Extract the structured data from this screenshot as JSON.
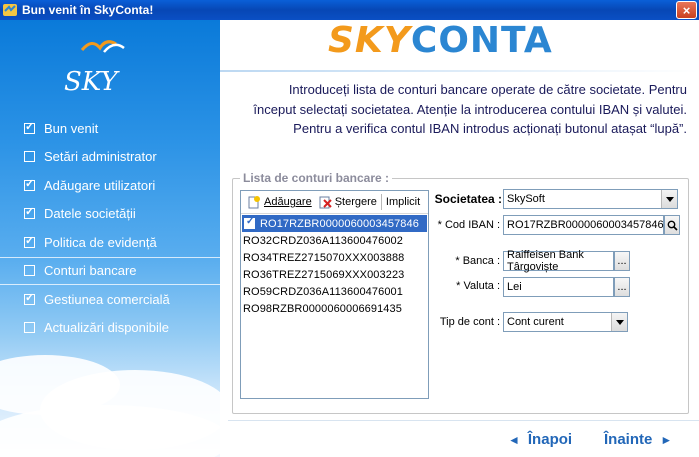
{
  "window": {
    "title": "Bun venit în SkyConta!",
    "close_symbol": "×"
  },
  "brand": {
    "sky": "SKY",
    "conta": "CONTA",
    "logo_text": "SKY"
  },
  "sidebar": {
    "items": [
      {
        "label": "Bun venit",
        "checked": true
      },
      {
        "label": "Setări administrator",
        "checked": false
      },
      {
        "label": "Adăugare utilizatori",
        "checked": true
      },
      {
        "label": "Datele societății",
        "checked": true
      },
      {
        "label": "Politica de evidență",
        "checked": true
      },
      {
        "label": "Conturi bancare",
        "checked": false,
        "active": true
      },
      {
        "label": "Gestiunea comercială",
        "checked": true
      },
      {
        "label": "Actualizări disponibile",
        "checked": false
      }
    ]
  },
  "intro": {
    "line1": "Introduceți lista de conturi bancare operate de către societate. Pentru",
    "line2": "început selectați societatea. Atenție la introducerea contului IBAN și valutei.",
    "line3": "Pentru a verifica contul IBAN introdus acționați butonul atașat “lupă”."
  },
  "group": {
    "label": "Lista de conturi bancare :"
  },
  "toolbar": {
    "add_label": "Adăugare",
    "delete_label": "Ștergere",
    "default_label": "Implicit"
  },
  "accounts": [
    "RO17RZBR0000060003457846",
    "RO32CRDZ036A113600476002",
    "RO34TREZ2715070XXX003888",
    "RO36TREZ2715069XXX003223",
    "RO59CRDZ036A113600476001",
    "RO98RZBR0000060006691435"
  ],
  "form": {
    "societate_label": "Societatea :",
    "societate_value": "SkySoft",
    "iban_label": "* Cod IBAN :",
    "iban_value": "RO17RZBR0000060003457846",
    "banca_label": "* Banca :",
    "banca_value": "Raiffeisen Bank Târgoviște",
    "valuta_label": "* Valuta :",
    "valuta_value": "Lei",
    "tipcont_label": "Tip de cont :",
    "tipcont_value": "Cont curent",
    "ellipsis": "..."
  },
  "nav": {
    "back_label": "Înapoi",
    "next_label": "Înainte",
    "back_arrow": "◄",
    "next_arrow": "►"
  },
  "colors": {
    "accent": "#2267b8",
    "selection": "#316ac5",
    "brand_orange": "#f39a1c",
    "brand_blue": "#2b86d2"
  }
}
